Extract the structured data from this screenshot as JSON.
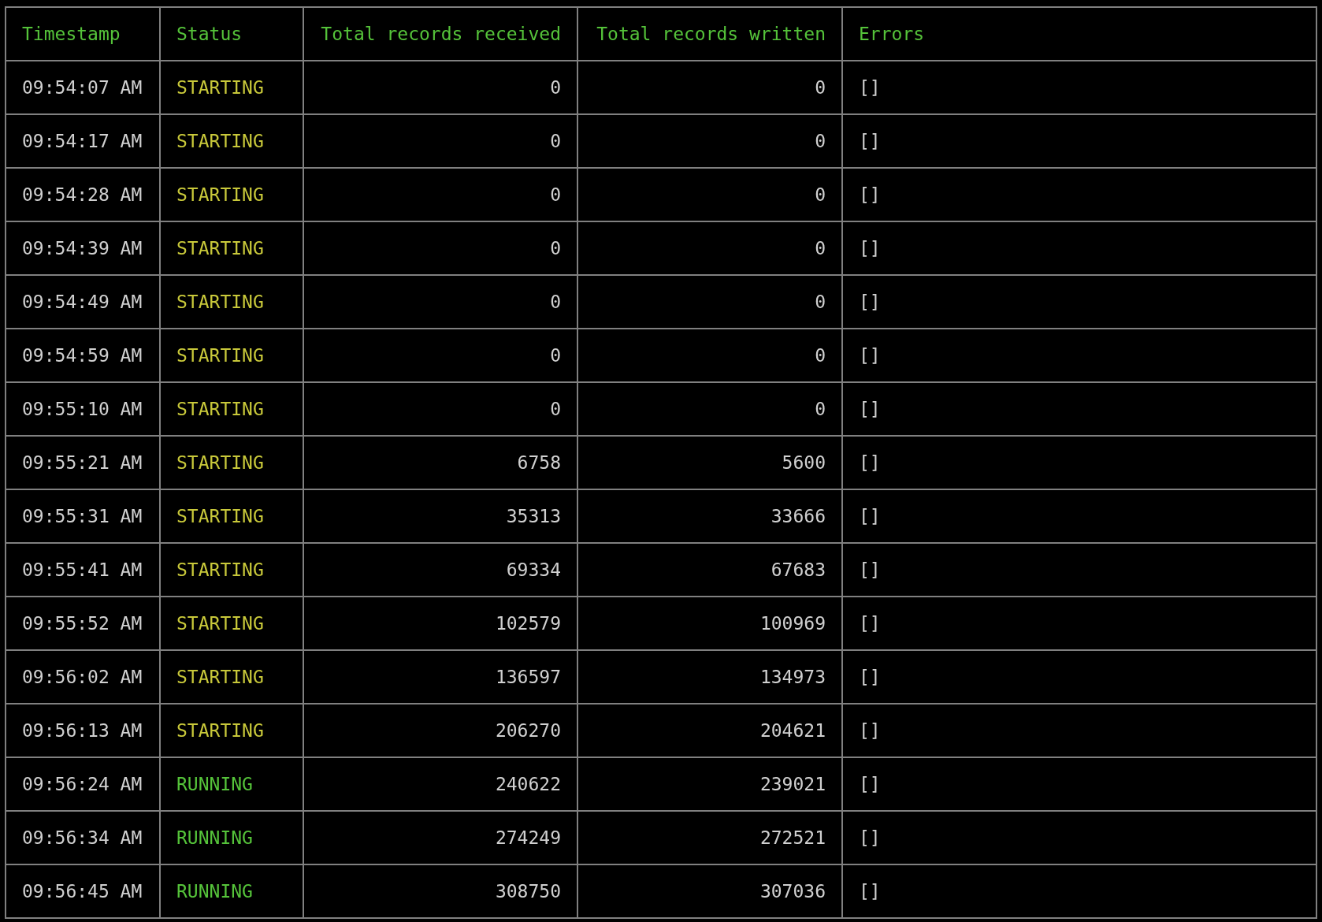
{
  "table": {
    "columns": [
      "Timestamp",
      "Status",
      "Total records received",
      "Total records written",
      "Errors"
    ],
    "rows": [
      {
        "timestamp": "09:54:07 AM",
        "status": "STARTING",
        "kind": "starting",
        "received": "0",
        "written": "0",
        "errors": "[]"
      },
      {
        "timestamp": "09:54:17 AM",
        "status": "STARTING",
        "kind": "starting",
        "received": "0",
        "written": "0",
        "errors": "[]"
      },
      {
        "timestamp": "09:54:28 AM",
        "status": "STARTING",
        "kind": "starting",
        "received": "0",
        "written": "0",
        "errors": "[]"
      },
      {
        "timestamp": "09:54:39 AM",
        "status": "STARTING",
        "kind": "starting",
        "received": "0",
        "written": "0",
        "errors": "[]"
      },
      {
        "timestamp": "09:54:49 AM",
        "status": "STARTING",
        "kind": "starting",
        "received": "0",
        "written": "0",
        "errors": "[]"
      },
      {
        "timestamp": "09:54:59 AM",
        "status": "STARTING",
        "kind": "starting",
        "received": "0",
        "written": "0",
        "errors": "[]"
      },
      {
        "timestamp": "09:55:10 AM",
        "status": "STARTING",
        "kind": "starting",
        "received": "0",
        "written": "0",
        "errors": "[]"
      },
      {
        "timestamp": "09:55:21 AM",
        "status": "STARTING",
        "kind": "starting",
        "received": "6758",
        "written": "5600",
        "errors": "[]"
      },
      {
        "timestamp": "09:55:31 AM",
        "status": "STARTING",
        "kind": "starting",
        "received": "35313",
        "written": "33666",
        "errors": "[]"
      },
      {
        "timestamp": "09:55:41 AM",
        "status": "STARTING",
        "kind": "starting",
        "received": "69334",
        "written": "67683",
        "errors": "[]"
      },
      {
        "timestamp": "09:55:52 AM",
        "status": "STARTING",
        "kind": "starting",
        "received": "102579",
        "written": "100969",
        "errors": "[]"
      },
      {
        "timestamp": "09:56:02 AM",
        "status": "STARTING",
        "kind": "starting",
        "received": "136597",
        "written": "134973",
        "errors": "[]"
      },
      {
        "timestamp": "09:56:13 AM",
        "status": "STARTING",
        "kind": "starting",
        "received": "206270",
        "written": "204621",
        "errors": "[]"
      },
      {
        "timestamp": "09:56:24 AM",
        "status": "RUNNING",
        "kind": "running",
        "received": "240622",
        "written": "239021",
        "errors": "[]"
      },
      {
        "timestamp": "09:56:34 AM",
        "status": "RUNNING",
        "kind": "running",
        "received": "274249",
        "written": "272521",
        "errors": "[]"
      },
      {
        "timestamp": "09:56:45 AM",
        "status": "RUNNING",
        "kind": "running",
        "received": "308750",
        "written": "307036",
        "errors": "[]"
      }
    ]
  }
}
